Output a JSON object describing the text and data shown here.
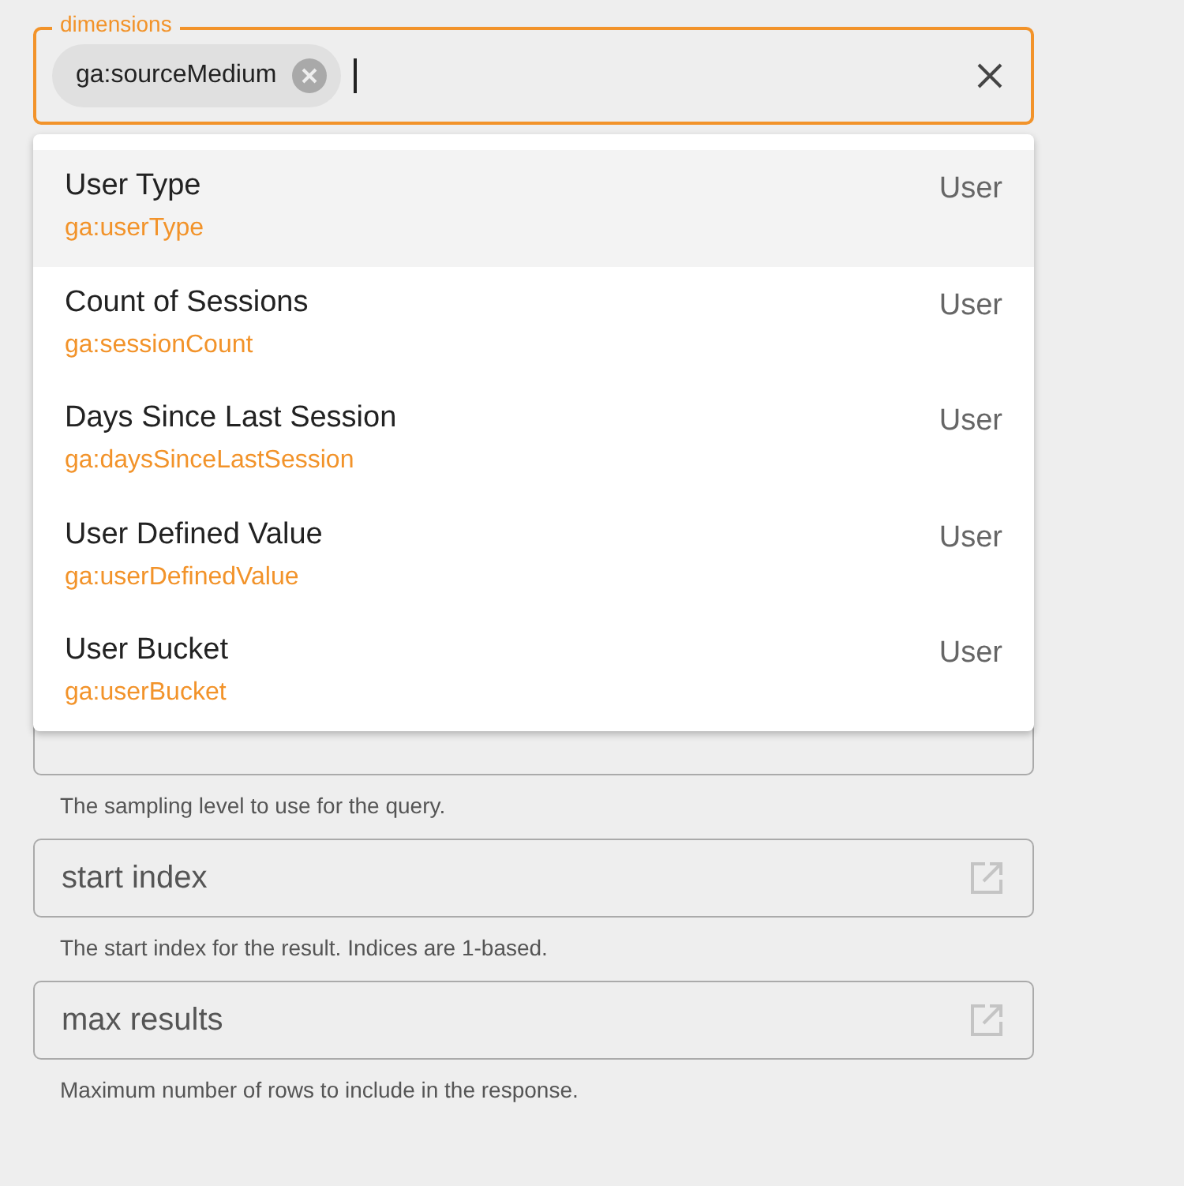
{
  "dimensions_field": {
    "label": "dimensions",
    "focused": true,
    "chips": [
      {
        "text": "ga:sourceMedium"
      }
    ]
  },
  "dropdown": {
    "items": [
      {
        "name": "User Type",
        "id_text": "ga:userType",
        "group": "User",
        "selected": true
      },
      {
        "name": "Count of Sessions",
        "id_text": "ga:sessionCount",
        "group": "User",
        "selected": false
      },
      {
        "name": "Days Since Last Session",
        "id_text": "ga:daysSinceLastSession",
        "group": "User",
        "selected": false
      },
      {
        "name": "User Defined Value",
        "id_text": "ga:userDefinedValue",
        "group": "User",
        "selected": false
      },
      {
        "name": "User Bucket",
        "id_text": "ga:userBucket",
        "group": "User",
        "selected": false
      }
    ]
  },
  "fields": [
    {
      "kind": "covered",
      "helper": "The sampling level to use for the query."
    },
    {
      "kind": "link",
      "placeholder": "start index",
      "helper": "The start index for the result. Indices are 1-based."
    },
    {
      "kind": "link",
      "placeholder": "max results",
      "helper": "Maximum number of rows to include in the response."
    }
  ]
}
